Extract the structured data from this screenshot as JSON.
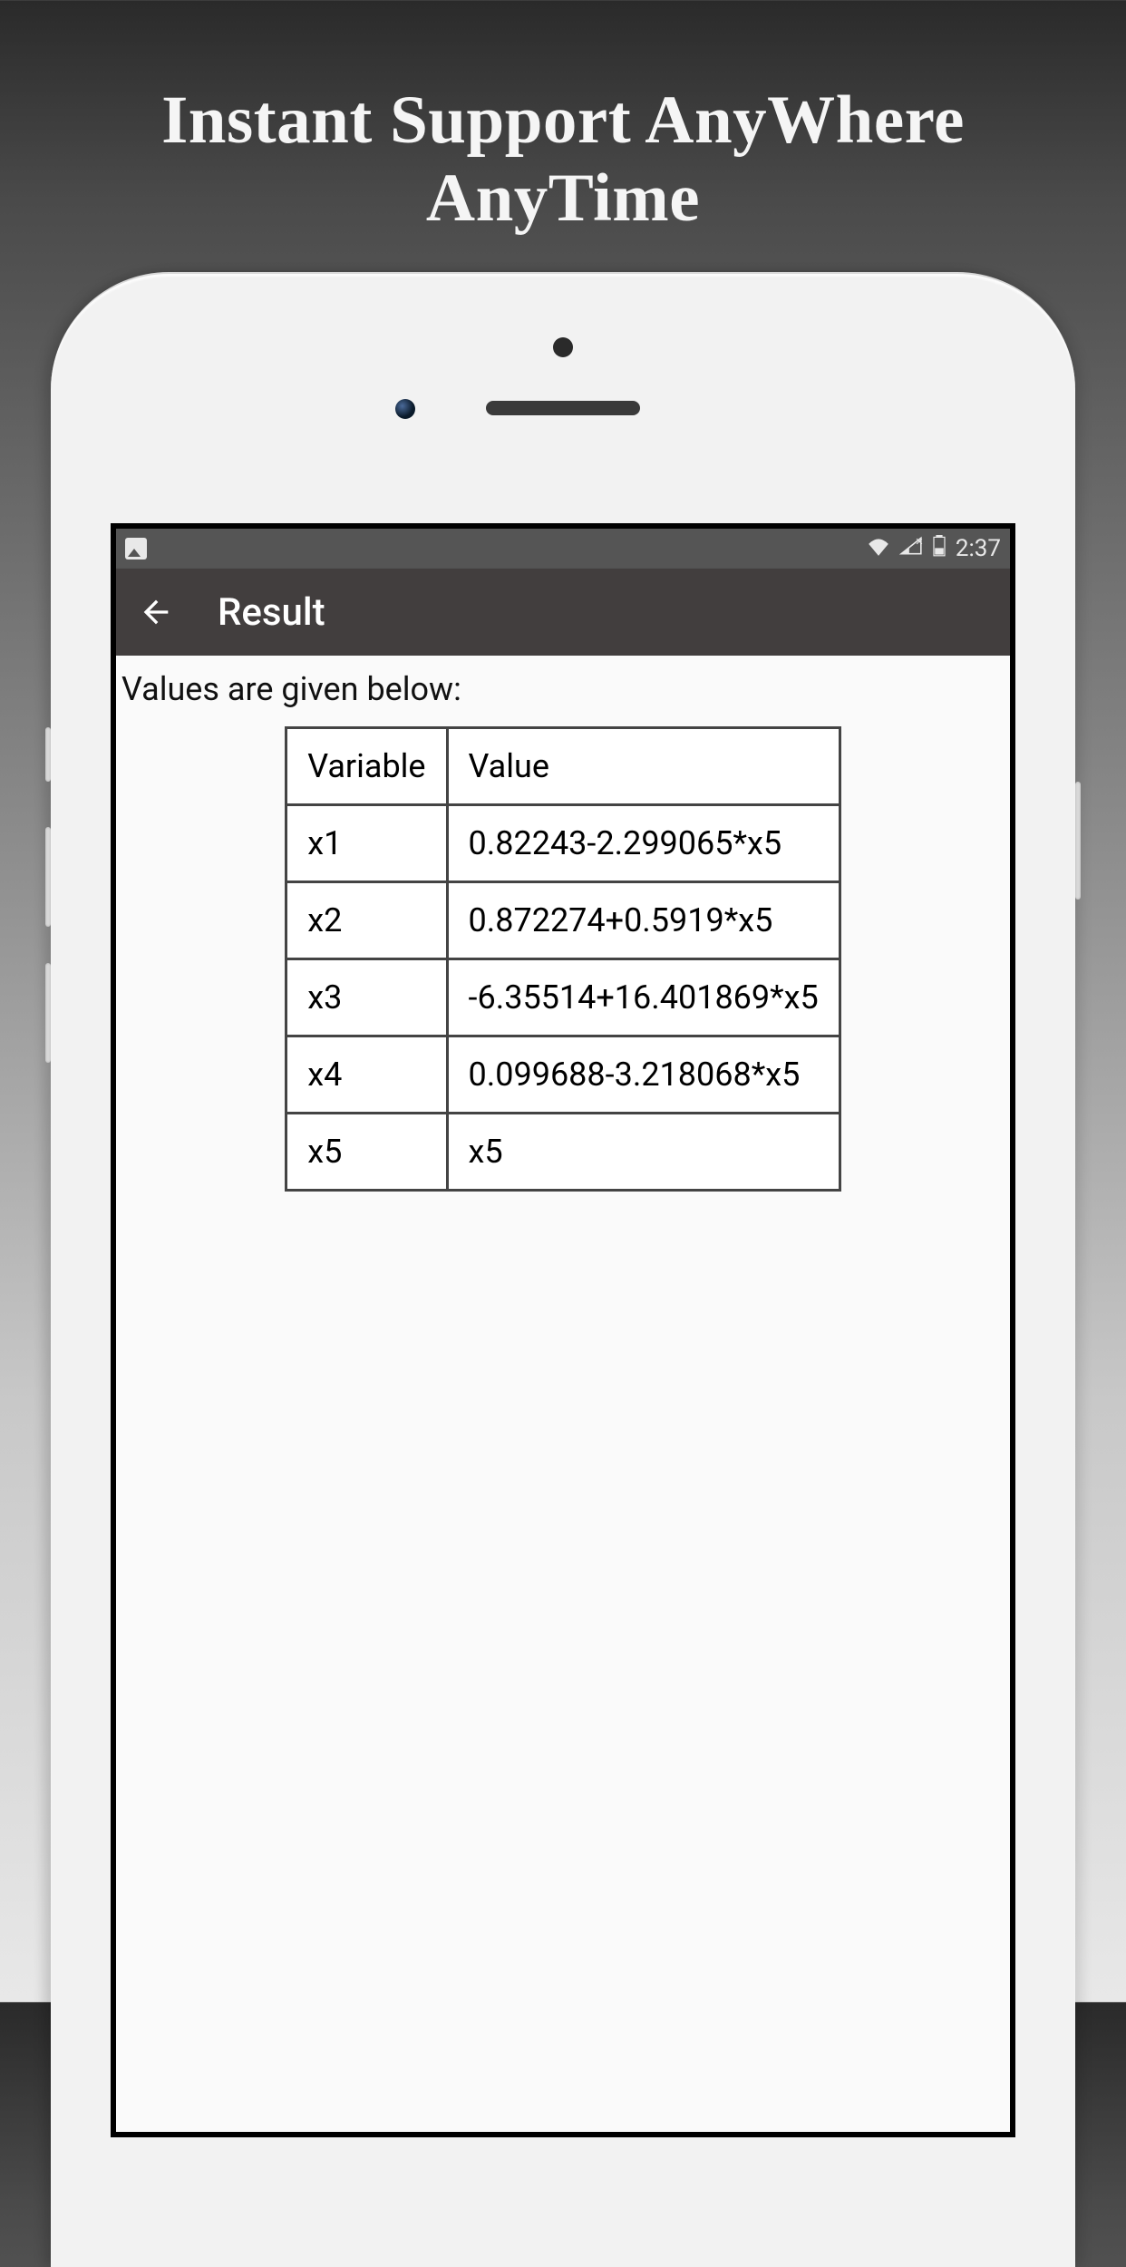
{
  "marketing": {
    "headline_line1": "Instant Support AnyWhere",
    "headline_line2": "AnyTime"
  },
  "statusbar": {
    "time": "2:37"
  },
  "appbar": {
    "title": "Result"
  },
  "content": {
    "description": "Values are given below:",
    "table": {
      "headers": {
        "col1": "Variable",
        "col2": "Value"
      },
      "rows": [
        {
          "variable": "x1",
          "value": "0.82243-2.299065*x5"
        },
        {
          "variable": "x2",
          "value": "0.872274+0.5919*x5"
        },
        {
          "variable": "x3",
          "value": "-6.35514+16.401869*x5"
        },
        {
          "variable": "x4",
          "value": "0.099688-3.218068*x5"
        },
        {
          "variable": "x5",
          "value": "x5"
        }
      ]
    }
  }
}
